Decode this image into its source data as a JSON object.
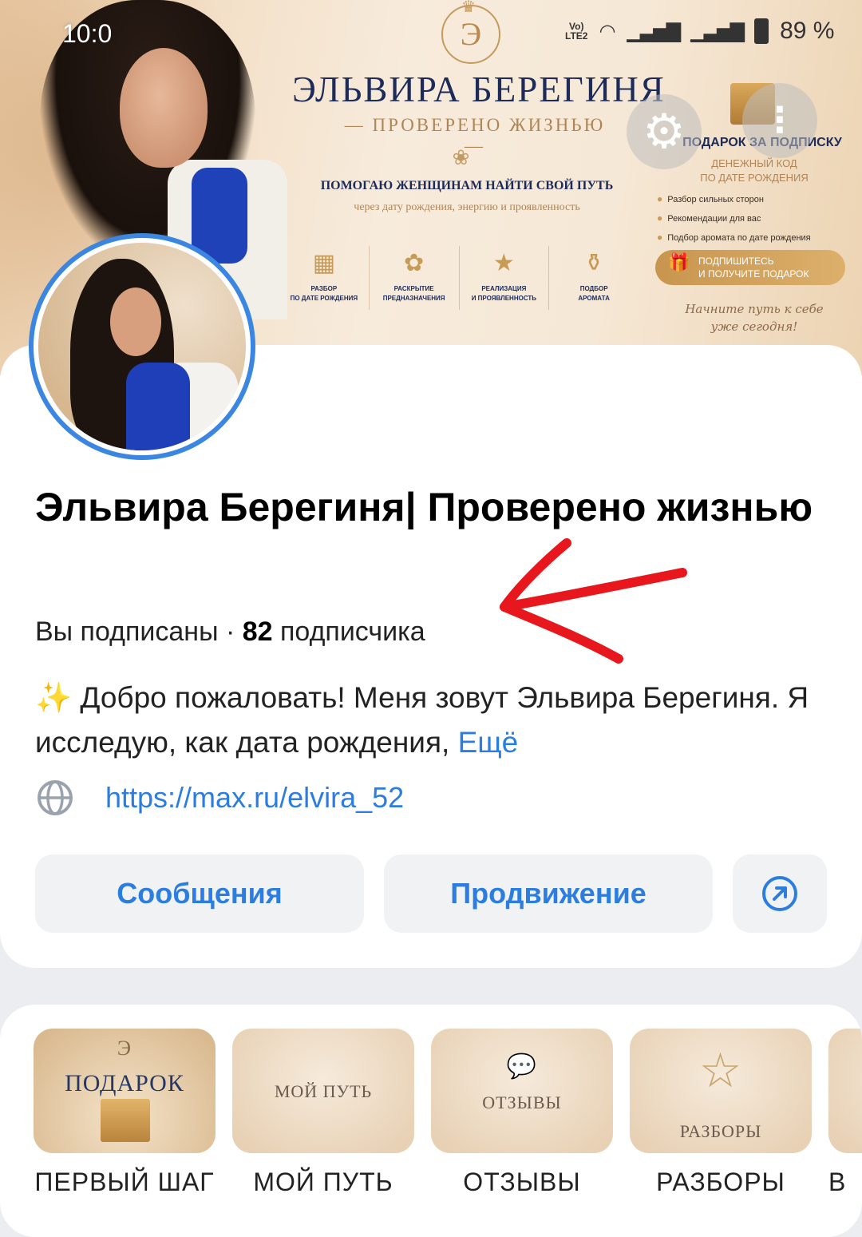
{
  "status_bar": {
    "time": "10:0",
    "volte": "Vo)\nLTE2",
    "battery": "89 %"
  },
  "cover": {
    "logo_letter": "Э",
    "brand_title": "ЭЛЬВИРА  БЕРЕГИНЯ",
    "brand_subtitle": "— ПРОВЕРЕНО ЖИЗНЬЮ —",
    "help_text": "ПОМОГАЮ ЖЕНЩИНАМ НАЙТИ СВОЙ ПУТЬ",
    "help_subtext": "через дату рождения, энергию и проявленность",
    "features": [
      {
        "icon": "calendar-icon",
        "label": "РАЗБОР\nПО ДАТЕ РОЖДЕНИЯ"
      },
      {
        "icon": "lotus-icon",
        "label": "РАСКРЫТИЕ\nПРЕДНАЗНАЧЕНИЯ"
      },
      {
        "icon": "star-icon",
        "label": "РЕАЛИЗАЦИЯ\nИ ПРОЯВЛЕННОСТЬ"
      },
      {
        "icon": "perfume-icon",
        "label": "ПОДБОР\nАРОМАТА"
      }
    ],
    "gift_title": "ПОДАРОК ЗА ПОДПИСКУ",
    "gift_code": "ДЕНЕЖНЫЙ КОД\nПО ДАТЕ РОЖДЕНИЯ",
    "gift_items": [
      "Разбор сильных сторон",
      "Рекомендации для вас",
      "Подбор аромата по дате рождения"
    ],
    "gift_button": "ПОДПИШИТЕСЬ\nИ ПОЛУЧИТЕ ПОДАРОК",
    "signature": "Начните путь к себе\nуже сегодня!"
  },
  "profile": {
    "name": "Эльвира Берегиня| Проверено жизнью",
    "subscribed": "Вы подписаны · ",
    "followers_count": "82",
    "followers_label": " подписчика",
    "bio_emoji": "✨",
    "bio": " Добро пожаловать! Меня зовут Эльвира Берегиня. Я исследую, как дата рождения, ",
    "bio_more": "Ещё",
    "link": "https://max.ru/elvira_52"
  },
  "actions": {
    "messages": "Сообщения",
    "promotion": "Продвижение"
  },
  "stories": [
    {
      "thumb_text": "ПОДАРОК",
      "label": "ПЕРВЫЙ ШАГ"
    },
    {
      "thumb_text": "МОЙ ПУТЬ",
      "label": "МОЙ ПУТЬ"
    },
    {
      "thumb_text": "ОТЗЫВЫ",
      "label": "ОТЗЫВЫ"
    },
    {
      "thumb_text": "РАЗБОРЫ",
      "label": "РАЗБОРЫ"
    },
    {
      "thumb_text": "",
      "label": "В"
    }
  ],
  "colors": {
    "accent": "#2b7de0",
    "avatar_ring": "#3a86e0",
    "annotation": "#e8161d",
    "gold": "#c59a5d",
    "navy": "#1c2b5a"
  }
}
